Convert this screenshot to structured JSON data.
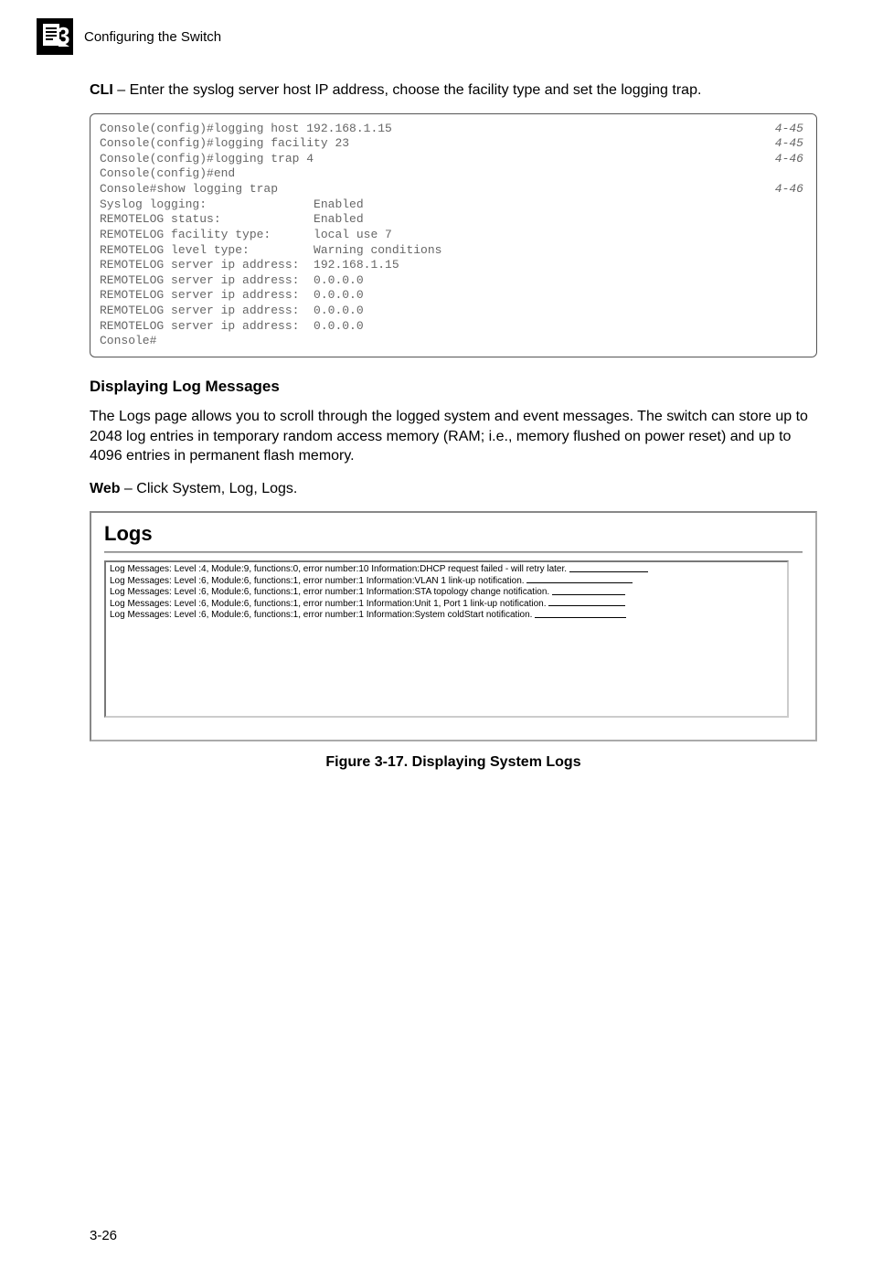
{
  "header": {
    "chapter_number": "3",
    "chapter_title": "Configuring the Switch"
  },
  "intro": {
    "cli_label": "CLI",
    "cli_text": " – Enter the syslog server host IP address, choose the facility type and set the logging trap."
  },
  "cli": {
    "lines": [
      {
        "text": "Console(config)#logging host 192.168.1.15",
        "ref": "4-45"
      },
      {
        "text": "Console(config)#logging facility 23",
        "ref": "4-45"
      },
      {
        "text": "Console(config)#logging trap 4",
        "ref": "4-46"
      },
      {
        "text": "Console(config)#end",
        "ref": ""
      },
      {
        "text": "Console#show logging trap",
        "ref": "4-46"
      },
      {
        "text": "Syslog logging:               Enabled",
        "ref": ""
      },
      {
        "text": "REMOTELOG status:             Enabled",
        "ref": ""
      },
      {
        "text": "REMOTELOG facility type:      local use 7",
        "ref": ""
      },
      {
        "text": "REMOTELOG level type:         Warning conditions",
        "ref": ""
      },
      {
        "text": "REMOTELOG server ip address:  192.168.1.15",
        "ref": ""
      },
      {
        "text": "REMOTELOG server ip address:  0.0.0.0",
        "ref": ""
      },
      {
        "text": "REMOTELOG server ip address:  0.0.0.0",
        "ref": ""
      },
      {
        "text": "REMOTELOG server ip address:  0.0.0.0",
        "ref": ""
      },
      {
        "text": "REMOTELOG server ip address:  0.0.0.0",
        "ref": ""
      },
      {
        "text": "Console#",
        "ref": ""
      }
    ]
  },
  "section": {
    "heading": "Displaying Log Messages",
    "para": "The Logs page allows you to scroll through the logged system and event messages. The switch can store up to 2048 log entries in temporary random access memory (RAM; i.e., memory flushed on power reset) and up to 4096 entries in permanent flash memory.",
    "web_label": "Web",
    "web_text": " – Click System, Log, Logs."
  },
  "screenshot": {
    "title": "Logs",
    "rows": [
      "Log Messages: Level :4, Module:9, functions:0, error number:10 Information:DHCP request failed - will retry later.",
      "Log Messages: Level :6, Module:6, functions:1, error number:1 Information:VLAN 1 link-up notification.",
      "Log Messages: Level :6, Module:6, functions:1, error number:1 Information:STA topology change notification.",
      "Log Messages: Level :6, Module:6, functions:1, error number:1 Information:Unit 1, Port 1 link-up notification.",
      "Log Messages: Level :6, Module:6, functions:1, error number:1 Information:System coldStart notification."
    ],
    "fill_widths": [
      86,
      116,
      80,
      84,
      100
    ]
  },
  "figure_caption": "Figure 3-17.  Displaying System Logs",
  "page_number": "3-26"
}
